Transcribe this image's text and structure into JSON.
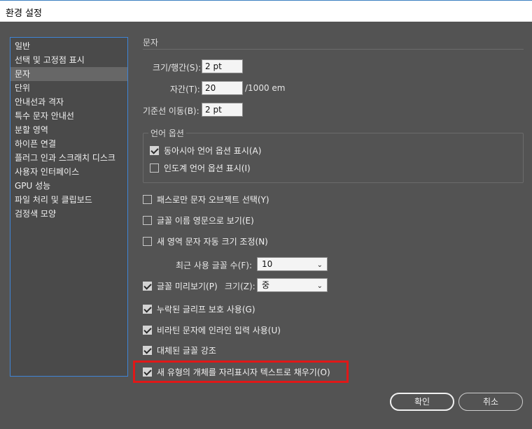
{
  "window": {
    "title": "환경 설정"
  },
  "categories": [
    {
      "label": "일반",
      "selected": false
    },
    {
      "label": "선택 및 고정점 표시",
      "selected": false
    },
    {
      "label": "문자",
      "selected": true
    },
    {
      "label": "단위",
      "selected": false
    },
    {
      "label": "안내선과 격자",
      "selected": false
    },
    {
      "label": "특수 문자 안내선",
      "selected": false
    },
    {
      "label": "분할 영역",
      "selected": false
    },
    {
      "label": "하이픈 연결",
      "selected": false
    },
    {
      "label": "플러그 인과 스크래치 디스크",
      "selected": false
    },
    {
      "label": "사용자 인터페이스",
      "selected": false
    },
    {
      "label": "GPU 성능",
      "selected": false
    },
    {
      "label": "파일 처리 및 클립보드",
      "selected": false
    },
    {
      "label": "검정색 모양",
      "selected": false
    }
  ],
  "type": {
    "section_title": "문자",
    "size_leading": {
      "label": "크기/행간(S):",
      "value": "2 pt"
    },
    "tracking": {
      "label": "자간(T):",
      "value": "20",
      "unit": "/1000 em"
    },
    "baseline_shift": {
      "label": "기준선 이동(B):",
      "value": "2 pt"
    },
    "language_options": {
      "legend": "언어 옵션",
      "east_asian": {
        "label": "동아시아 언어 옵션 표시(A)",
        "checked": true
      },
      "indic": {
        "label": "인도계 언어 옵션 표시(I)",
        "checked": false
      }
    },
    "type_object_select": {
      "label": "패스로만 문자 오브젝트 선택(Y)",
      "checked": false
    },
    "font_names_english": {
      "label": "글꼴 이름 영문으로 보기(E)",
      "checked": false
    },
    "auto_size_new_area": {
      "label": "새 영역 문자 자동 크기 조정(N)",
      "checked": false
    },
    "recent_fonts": {
      "label": "최근 사용 글꼴 수(F):",
      "value": "10"
    },
    "font_preview": {
      "label": "글꼴 미리보기(P)",
      "checked": true,
      "size_label": "크기(Z):",
      "size_value": "중"
    },
    "missing_glyph": {
      "label": "누락된 글리프 보호 사용(G)",
      "checked": true
    },
    "inline_input": {
      "label": "비라틴 문자에 인라인 입력 사용(U)",
      "checked": true
    },
    "highlight_substituted": {
      "label": "대체된 글꼴 강조",
      "checked": true
    },
    "fill_placeholder": {
      "label": "새 유형의 개체를 자리표시자 텍스트로 채우기(O)",
      "checked": true
    }
  },
  "buttons": {
    "ok": "확인",
    "cancel": "취소"
  },
  "colors": {
    "highlight": "#e01818",
    "list_border": "#3f85d6",
    "panel_bg": "#535353"
  }
}
